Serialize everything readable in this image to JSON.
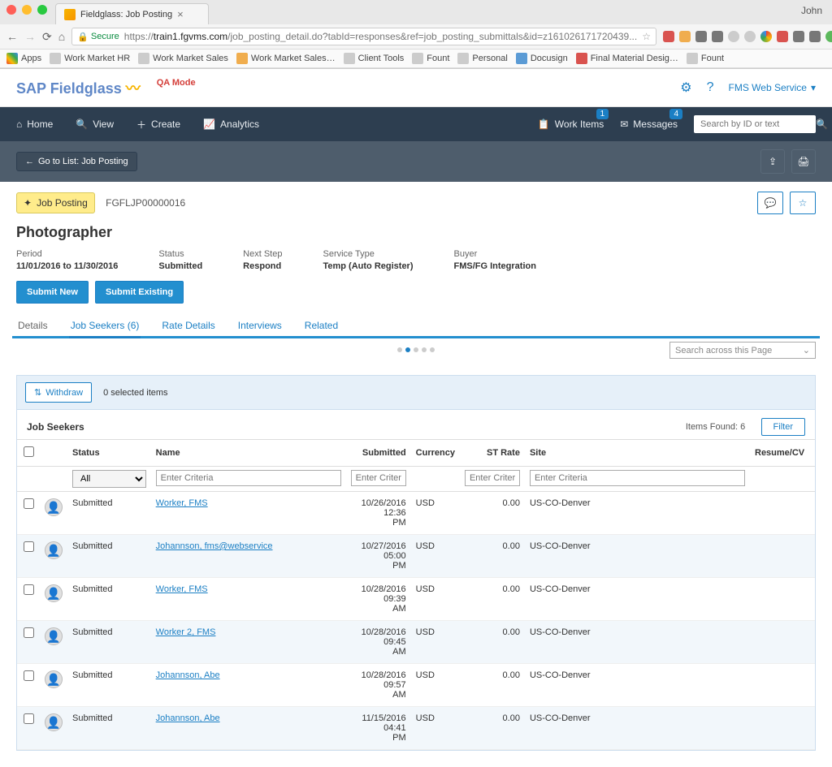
{
  "browser": {
    "tab_title": "Fieldglass: Job Posting",
    "user": "John",
    "secure_label": "Secure",
    "url_prefix": "https://",
    "url_host": "train1.fgvms.com",
    "url_path": "/job_posting_detail.do?tabId=responses&ref=job_posting_submittals&id=z161026171720439...",
    "bookmarks": [
      "Apps",
      "Work Market HR",
      "Work Market Sales",
      "Work Market Sales…",
      "Client Tools",
      "Fount",
      "Personal",
      "Docusign",
      "Final Material Desig…",
      "Fount"
    ]
  },
  "app": {
    "logo_sap": "SAP",
    "logo_fg": " Fieldglass",
    "qa_mode": "QA Mode",
    "fms_link": "FMS Web Service"
  },
  "nav": {
    "home": "Home",
    "view": "View",
    "create": "Create",
    "analytics": "Analytics",
    "work_items": "Work Items",
    "work_items_badge": "1",
    "messages": "Messages",
    "messages_badge": "4",
    "search_placeholder": "Search by ID or text"
  },
  "sub": {
    "back": "Go to List: Job Posting"
  },
  "posting": {
    "pill_label": "Job Posting",
    "id": "FGFLJP00000016",
    "title": "Photographer",
    "meta": {
      "period_label": "Period",
      "period_value": "11/01/2016 to 11/30/2016",
      "status_label": "Status",
      "status_value": "Submitted",
      "nextstep_label": "Next Step",
      "nextstep_value": "Respond",
      "servicetype_label": "Service Type",
      "servicetype_value": "Temp (Auto Register)",
      "buyer_label": "Buyer",
      "buyer_value": "FMS/FG Integration"
    },
    "submit_new": "Submit New",
    "submit_existing": "Submit Existing"
  },
  "tabs": {
    "details": "Details",
    "jobseekers": "Job Seekers (6)",
    "ratedetails": "Rate Details",
    "interviews": "Interviews",
    "related": "Related"
  },
  "search_across_placeholder": "Search across this Page",
  "panel": {
    "withdraw": "Withdraw",
    "selected": "0 selected items",
    "heading": "Job Seekers",
    "items_found": "Items Found:  6",
    "filter": "Filter"
  },
  "columns": {
    "status": "Status",
    "name": "Name",
    "submitted": "Submitted",
    "currency": "Currency",
    "strate": "ST Rate",
    "site": "Site",
    "resume": "Resume/CV"
  },
  "filter_row": {
    "status_all": "All",
    "enter_criteria": "Enter Criteria"
  },
  "rows": [
    {
      "status": "Submitted",
      "name": "Worker, FMS",
      "submitted": "10/26/2016 12:36 PM",
      "currency": "USD",
      "strate": "0.00",
      "site": "US-CO-Denver"
    },
    {
      "status": "Submitted",
      "name": "Johannson, fms@webservice",
      "submitted": "10/27/2016 05:00 PM",
      "currency": "USD",
      "strate": "0.00",
      "site": "US-CO-Denver"
    },
    {
      "status": "Submitted",
      "name": "Worker, FMS",
      "submitted": "10/28/2016 09:39 AM",
      "currency": "USD",
      "strate": "0.00",
      "site": "US-CO-Denver"
    },
    {
      "status": "Submitted",
      "name": "Worker 2, FMS",
      "submitted": "10/28/2016 09:45 AM",
      "currency": "USD",
      "strate": "0.00",
      "site": "US-CO-Denver"
    },
    {
      "status": "Submitted",
      "name": "Johannson, Abe",
      "submitted": "10/28/2016 09:57 AM",
      "currency": "USD",
      "strate": "0.00",
      "site": "US-CO-Denver"
    },
    {
      "status": "Submitted",
      "name": "Johannson, Abe",
      "submitted": "11/15/2016 04:41 PM",
      "currency": "USD",
      "strate": "0.00",
      "site": "US-CO-Denver"
    }
  ]
}
